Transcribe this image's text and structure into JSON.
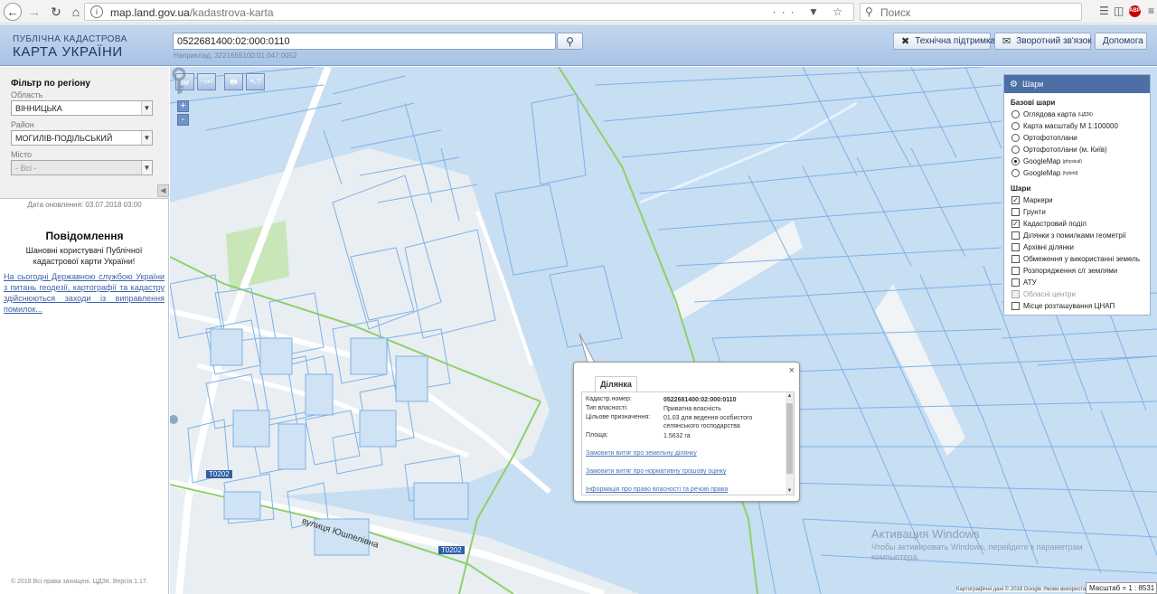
{
  "browser": {
    "url_host": "map.land.gov.ua",
    "url_path": "/kadastrova-karta",
    "search_placeholder": "Поиск"
  },
  "header": {
    "logo_sub": "ПУБЛІЧНА КАДАСТРОВА",
    "logo_main": "КАРТА УКРАЇНИ",
    "search_value": "0522681400:02:000:0110",
    "example": "Наприклад: 3221655100:01:047:0052",
    "buttons": {
      "support": "Технічна підтримка",
      "feedback": "Зворотний зв'язок",
      "help": "Допомога"
    }
  },
  "filter": {
    "title": "Фільтр по регіону",
    "oblast_label": "Область",
    "oblast_value": "ВІННИЦЬКА",
    "rayon_label": "Район",
    "rayon_value": "МОГИЛІВ-ПОДІЛЬСЬКИЙ",
    "misto_label": "Місто",
    "misto_value": "- Всі -"
  },
  "update_date": "Дата оновлення: 03.07.2018 03:00",
  "notice": {
    "title": "Повідомлення",
    "body": "Шановні користувачі Публічної кадастрової карти України!",
    "link": "На сьогодні Державною службою України з питань геодезії, картографії та кадастру здійснюються заходи із виправлення помилок..."
  },
  "copyright": "© 2018 Всі права захищені. ЦДЗК. Версія 1.17.",
  "map": {
    "tools": [
      "|м",
      "⊣↵",
      "🖶",
      "↖?"
    ],
    "zoom_in": "+",
    "zoom_out": "-",
    "road_labels": [
      "Т0202",
      "Т0202"
    ],
    "street_name": "вулиця Юшпелівна",
    "attribution": "Картографічні дані © 2018 Google   Умови використання",
    "scale": "Масштаб = 1 : 8531"
  },
  "layers": {
    "title": "Шари",
    "base_title": "Базові шари",
    "base": [
      {
        "label": "Оглядова карта",
        "sup": "(ЦДЗК)",
        "selected": false
      },
      {
        "label": "Карта масштабу М 1:100000",
        "sup": "",
        "selected": false
      },
      {
        "label": "Ортофотоплани",
        "sup": "",
        "selected": false
      },
      {
        "label": "Ортофотоплани (м. Київ)",
        "sup": "",
        "selected": false
      },
      {
        "label": "GoogleMap",
        "sup": "(physical)",
        "selected": true
      },
      {
        "label": "GoogleMap",
        "sup": "(hybrid)",
        "selected": false
      }
    ],
    "overlay_title": "Шари",
    "overlays": [
      {
        "label": "Маркери",
        "checked": true,
        "disabled": false
      },
      {
        "label": "Грунти",
        "checked": false,
        "disabled": false
      },
      {
        "label": "Кадастровий поділ",
        "checked": true,
        "disabled": false
      },
      {
        "label": "Ділянки з помилками геометрії",
        "checked": false,
        "disabled": false
      },
      {
        "label": "Архівні ділянки",
        "checked": false,
        "disabled": false
      },
      {
        "label": "Обмеження у використанні земель",
        "checked": false,
        "disabled": false
      },
      {
        "label": "Розпорядження с/г землями",
        "checked": false,
        "disabled": false
      },
      {
        "label": "АТУ",
        "checked": false,
        "disabled": false
      },
      {
        "label": "Обласні центри",
        "checked": false,
        "disabled": true
      },
      {
        "label": "Місце розташування ЦНАП",
        "checked": false,
        "disabled": false
      }
    ]
  },
  "popup": {
    "tab": "Ділянка",
    "close": "×",
    "rows": [
      {
        "k": "Кадастр.номер:",
        "v": "0522681400:02:000:0110"
      },
      {
        "k": "Тип власності:",
        "v": "Приватна власність"
      },
      {
        "k": "Цільове призначення:",
        "v": "01.03 для ведення особистого селянського господарства"
      },
      {
        "k": "Площа:",
        "v": "1.5632 га"
      }
    ],
    "links": [
      "Замовити витяг про земельну ділянку",
      "Замовити витяг про нормативну грошову оцінку",
      "Інформація про право власності та речові права"
    ]
  },
  "watermark": {
    "title": "Активация Windows",
    "body": "Чтобы активировать Windows, перейдите к параметрам компьютера."
  }
}
